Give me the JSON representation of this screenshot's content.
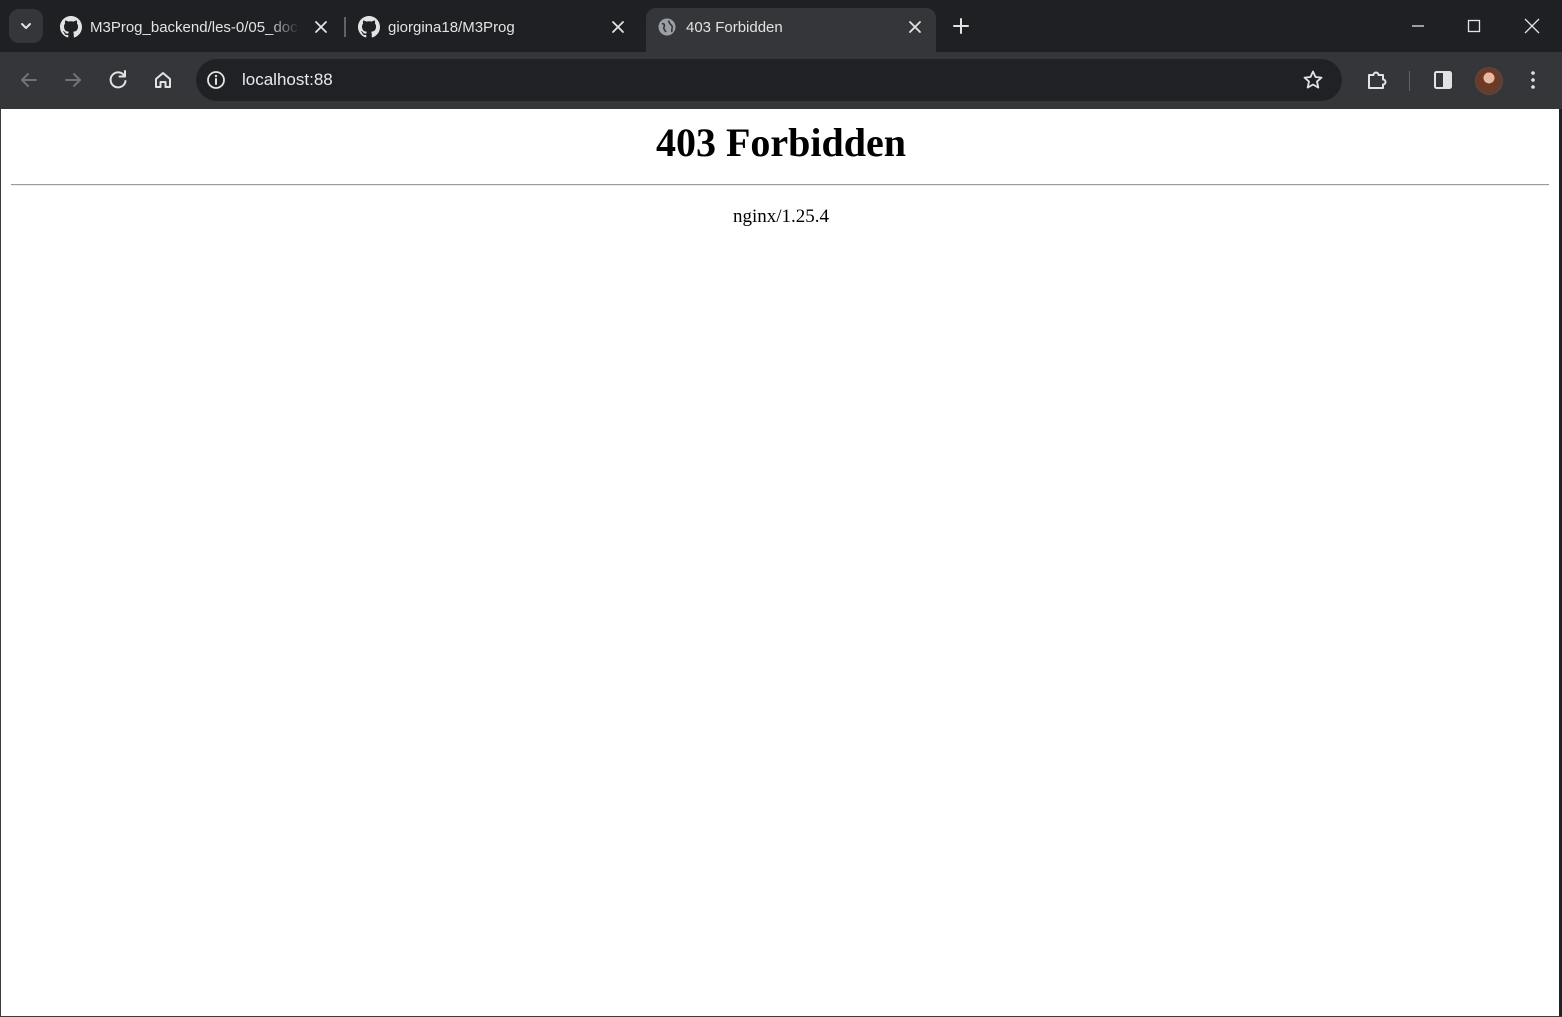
{
  "browser": {
    "tabs": [
      {
        "title": "M3Prog_backend/les-0/05_doc",
        "favicon": "github-icon",
        "active": false
      },
      {
        "title": "giorgina18/M3Prog",
        "favicon": "github-icon",
        "active": false
      },
      {
        "title": "403 Forbidden",
        "favicon": "globe-icon",
        "active": true
      }
    ],
    "address_bar": {
      "url": "localhost:88"
    },
    "colors": {
      "tabstrip": "#1f2023",
      "toolbar": "#35363a",
      "omnibox": "#202124",
      "text": "#e3e3e3"
    }
  },
  "page": {
    "heading": "403 Forbidden",
    "server": "nginx/1.25.4"
  }
}
